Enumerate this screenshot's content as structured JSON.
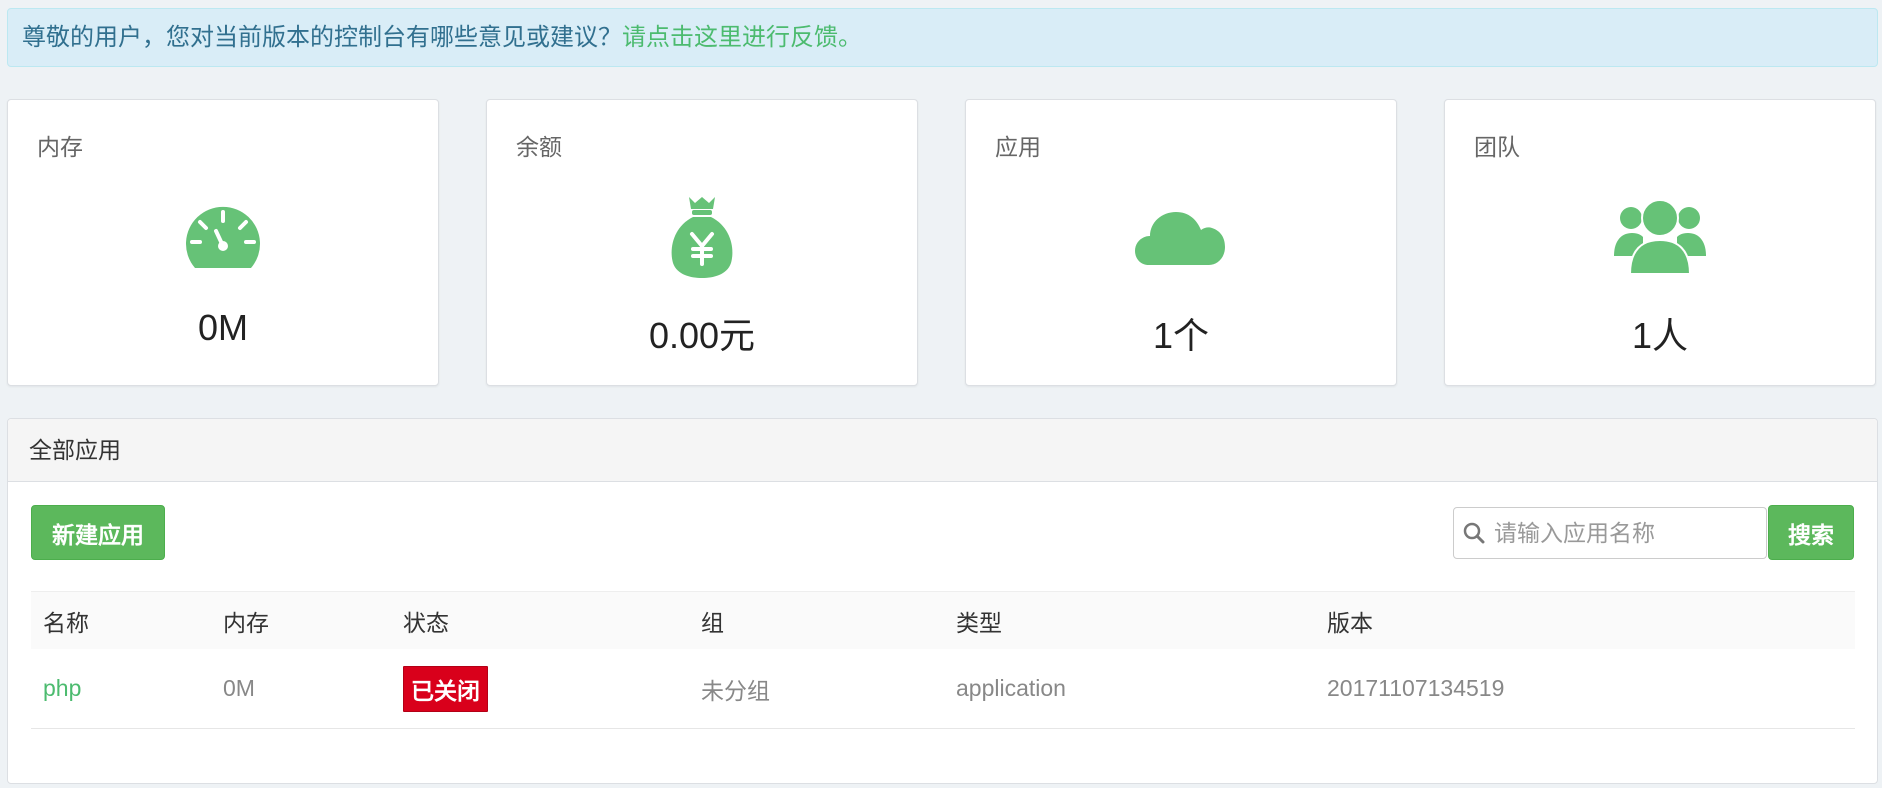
{
  "alert": {
    "text": "尊敬的用户，您对当前版本的控制台有哪些意见或建议？",
    "link": "请点击这里进行反馈。"
  },
  "stats": [
    {
      "title": "内存",
      "value": "0M",
      "icon": "gauge-icon"
    },
    {
      "title": "余额",
      "value": "0.00元",
      "icon": "money-bag-icon"
    },
    {
      "title": "应用",
      "value": "1个",
      "icon": "cloud-icon"
    },
    {
      "title": "团队",
      "value": "1人",
      "icon": "users-icon"
    }
  ],
  "panel": {
    "title": "全部应用",
    "new_button": "新建应用",
    "search_placeholder": "请输入应用名称",
    "search_button": "搜索"
  },
  "table": {
    "headers": [
      "名称",
      "内存",
      "状态",
      "组",
      "类型",
      "版本"
    ],
    "rows": [
      {
        "name": "php",
        "memory": "0M",
        "status": "已关闭",
        "group": "未分组",
        "type": "application",
        "version": "20171107134519"
      }
    ]
  },
  "colors": {
    "accent": "#5cb85c",
    "icon_green": "#66c277",
    "status_closed": "#d9001b",
    "alert_bg": "#d9edf7"
  }
}
